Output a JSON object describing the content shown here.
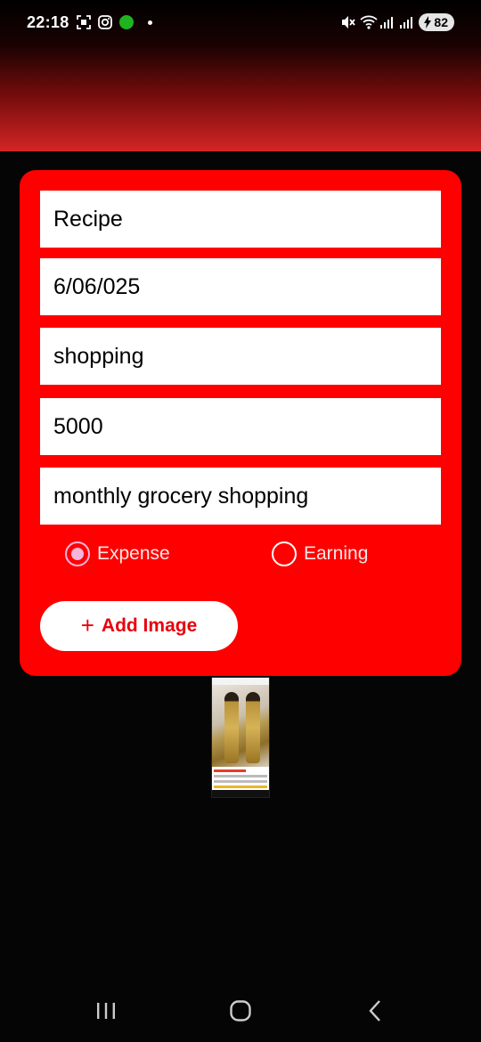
{
  "status_bar": {
    "time": "22:18",
    "battery": "82",
    "icons": [
      "screenshot-icon",
      "instagram-icon",
      "green-dot-icon",
      "dot-icon",
      "mute-icon",
      "wifi-icon",
      "signal-icon",
      "signal-icon",
      "charging-icon"
    ]
  },
  "form": {
    "fields": [
      {
        "name": "title",
        "value": "Recipe"
      },
      {
        "name": "date",
        "value": "6/06/025"
      },
      {
        "name": "category",
        "value": "shopping"
      },
      {
        "name": "amount",
        "value": "5000"
      },
      {
        "name": "description",
        "value": "monthly grocery shopping"
      }
    ],
    "radio_options": [
      {
        "label": "Expense",
        "selected": true
      },
      {
        "label": "Earning",
        "selected": false
      }
    ],
    "add_image_button": {
      "icon": "plus-icon",
      "label": "Add Image"
    }
  },
  "colors": {
    "card": "#ff0000",
    "accent_radio": "#f4b4dc",
    "button_text": "#e8000b",
    "background": "#050505"
  },
  "nav_bar": {
    "icons": [
      "recent-apps-icon",
      "home-icon",
      "back-icon"
    ]
  }
}
